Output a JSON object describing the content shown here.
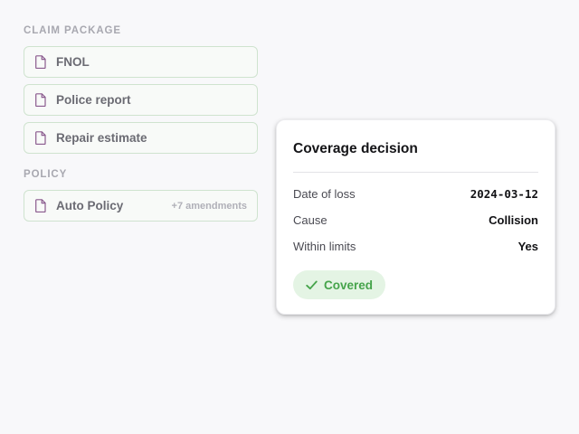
{
  "claim_package": {
    "heading": "CLAIM PACKAGE",
    "documents": [
      {
        "label": "FNOL",
        "icon": "document-icon"
      },
      {
        "label": "Police report",
        "icon": "document-icon"
      },
      {
        "label": "Repair estimate",
        "icon": "document-icon"
      }
    ]
  },
  "policy": {
    "heading": "POLICY",
    "document": {
      "label": "Auto Policy",
      "extra": "+7 amendments",
      "icon": "document-icon"
    }
  },
  "coverage_decision": {
    "title": "Coverage decision",
    "rows": [
      {
        "label": "Date of loss",
        "value": "2024-03-12"
      },
      {
        "label": "Cause",
        "value": "Collision"
      },
      {
        "label": "Within limits",
        "value": "Yes"
      }
    ],
    "status": {
      "label": "Covered",
      "icon": "check-icon",
      "color": "#46a44b",
      "background": "#e4f4e4"
    }
  },
  "colors": {
    "doc_icon": "#8a5a8e",
    "card_border": "#cfe3cf",
    "section_heading": "#a8a8b0"
  }
}
